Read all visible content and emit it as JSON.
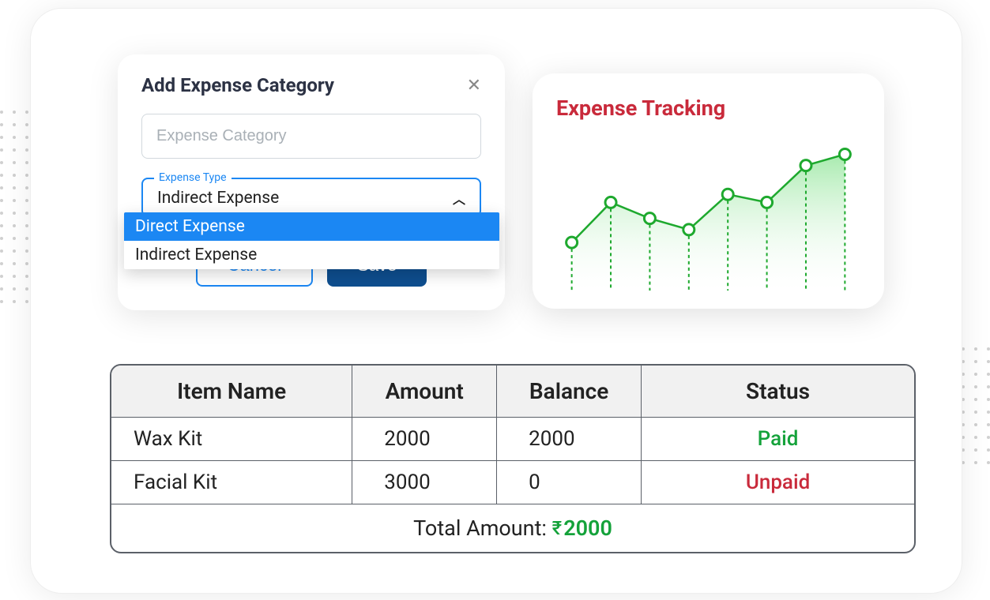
{
  "modal": {
    "title": "Add Expense Category",
    "close_icon": "✕",
    "input_placeholder": "Expense Category",
    "select_label": "Expense Type",
    "select_value": "Indirect Expense",
    "options": [
      "Direct Expense",
      "Indirect Expense"
    ],
    "cancel_label": "Cancel",
    "save_label": "Save"
  },
  "chart": {
    "title": "Expense Tracking"
  },
  "chart_data": {
    "type": "line",
    "x": [
      1,
      2,
      3,
      4,
      5,
      6,
      7,
      8
    ],
    "values": [
      30,
      55,
      45,
      38,
      60,
      55,
      78,
      85
    ],
    "ylim": [
      0,
      100
    ],
    "area_fill": true,
    "color": "#1ea92e"
  },
  "table": {
    "headers": [
      "Item Name",
      "Amount",
      "Balance",
      "Status"
    ],
    "rows": [
      {
        "name": "Wax Kit",
        "amount": "2000",
        "balance": "2000",
        "status": "Paid"
      },
      {
        "name": "Facial Kit",
        "amount": "3000",
        "balance": "0",
        "status": "Unpaid"
      }
    ],
    "total_label": "Total Amount:",
    "total_currency": "₹",
    "total_value": "2000"
  },
  "colors": {
    "accent_blue": "#1b87f3",
    "primary_blue": "#0e4e8f",
    "green": "#14a23a",
    "red": "#c92a3b"
  }
}
